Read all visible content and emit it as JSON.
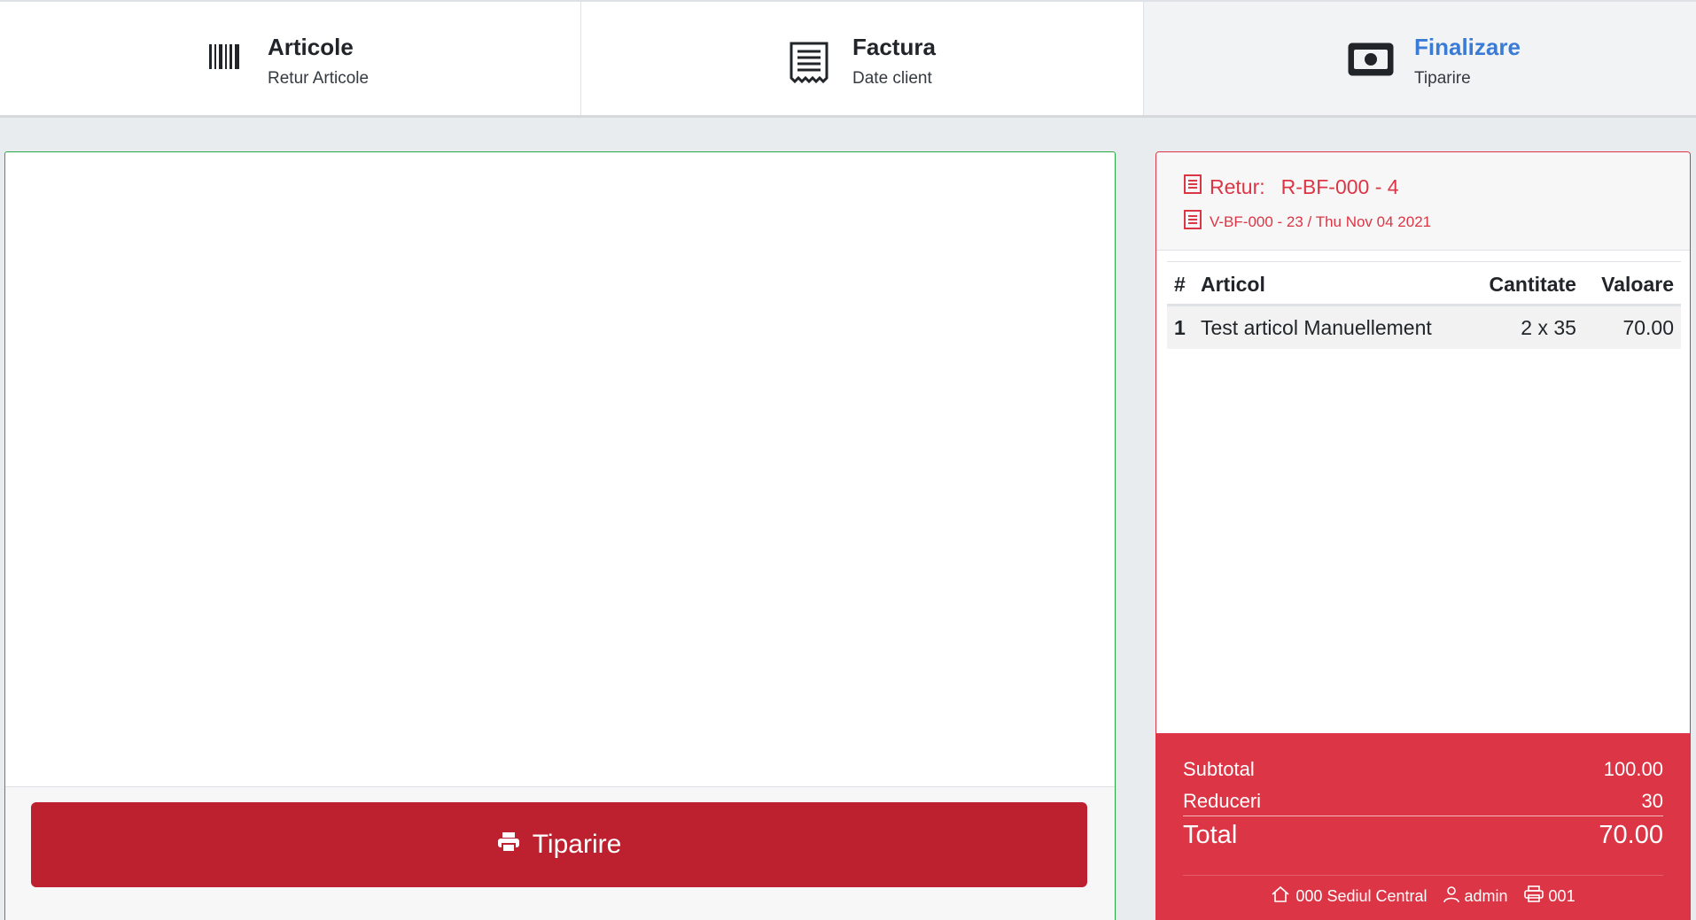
{
  "stepper": {
    "steps": [
      {
        "title": "Articole",
        "subtitle": "Retur Articole",
        "icon": "barcode-icon"
      },
      {
        "title": "Factura",
        "subtitle": "Date client",
        "icon": "receipt-icon"
      },
      {
        "title": "Finalizare",
        "subtitle": "Tiparire",
        "icon": "money-bill-icon",
        "active": true
      }
    ]
  },
  "preview": {
    "print_label": "Tiparire"
  },
  "receipt": {
    "retur_label": "Retur:",
    "retur_number": "R-BF-000 - 4",
    "original_doc": "V-BF-000 - 23 / Thu Nov 04 2021",
    "columns": {
      "num": "#",
      "article": "Articol",
      "qty": "Cantitate",
      "value": "Valoare"
    },
    "rows": [
      {
        "num": "1",
        "article": "Test articol Manuellement",
        "qty": "2 x 35",
        "value": "70.00"
      }
    ],
    "totals": {
      "subtotal_label": "Subtotal",
      "subtotal": "100.00",
      "discount_label": "Reduceri",
      "discount": "30",
      "total_label": "Total",
      "total": "70.00"
    },
    "meta": {
      "location": "000 Sediul Central",
      "user": "admin",
      "printer": "001"
    }
  },
  "colors": {
    "accent_red": "#dc3545",
    "button_red": "#bd202f",
    "active_blue": "#3a7bd5",
    "preview_border": "#28a745"
  }
}
